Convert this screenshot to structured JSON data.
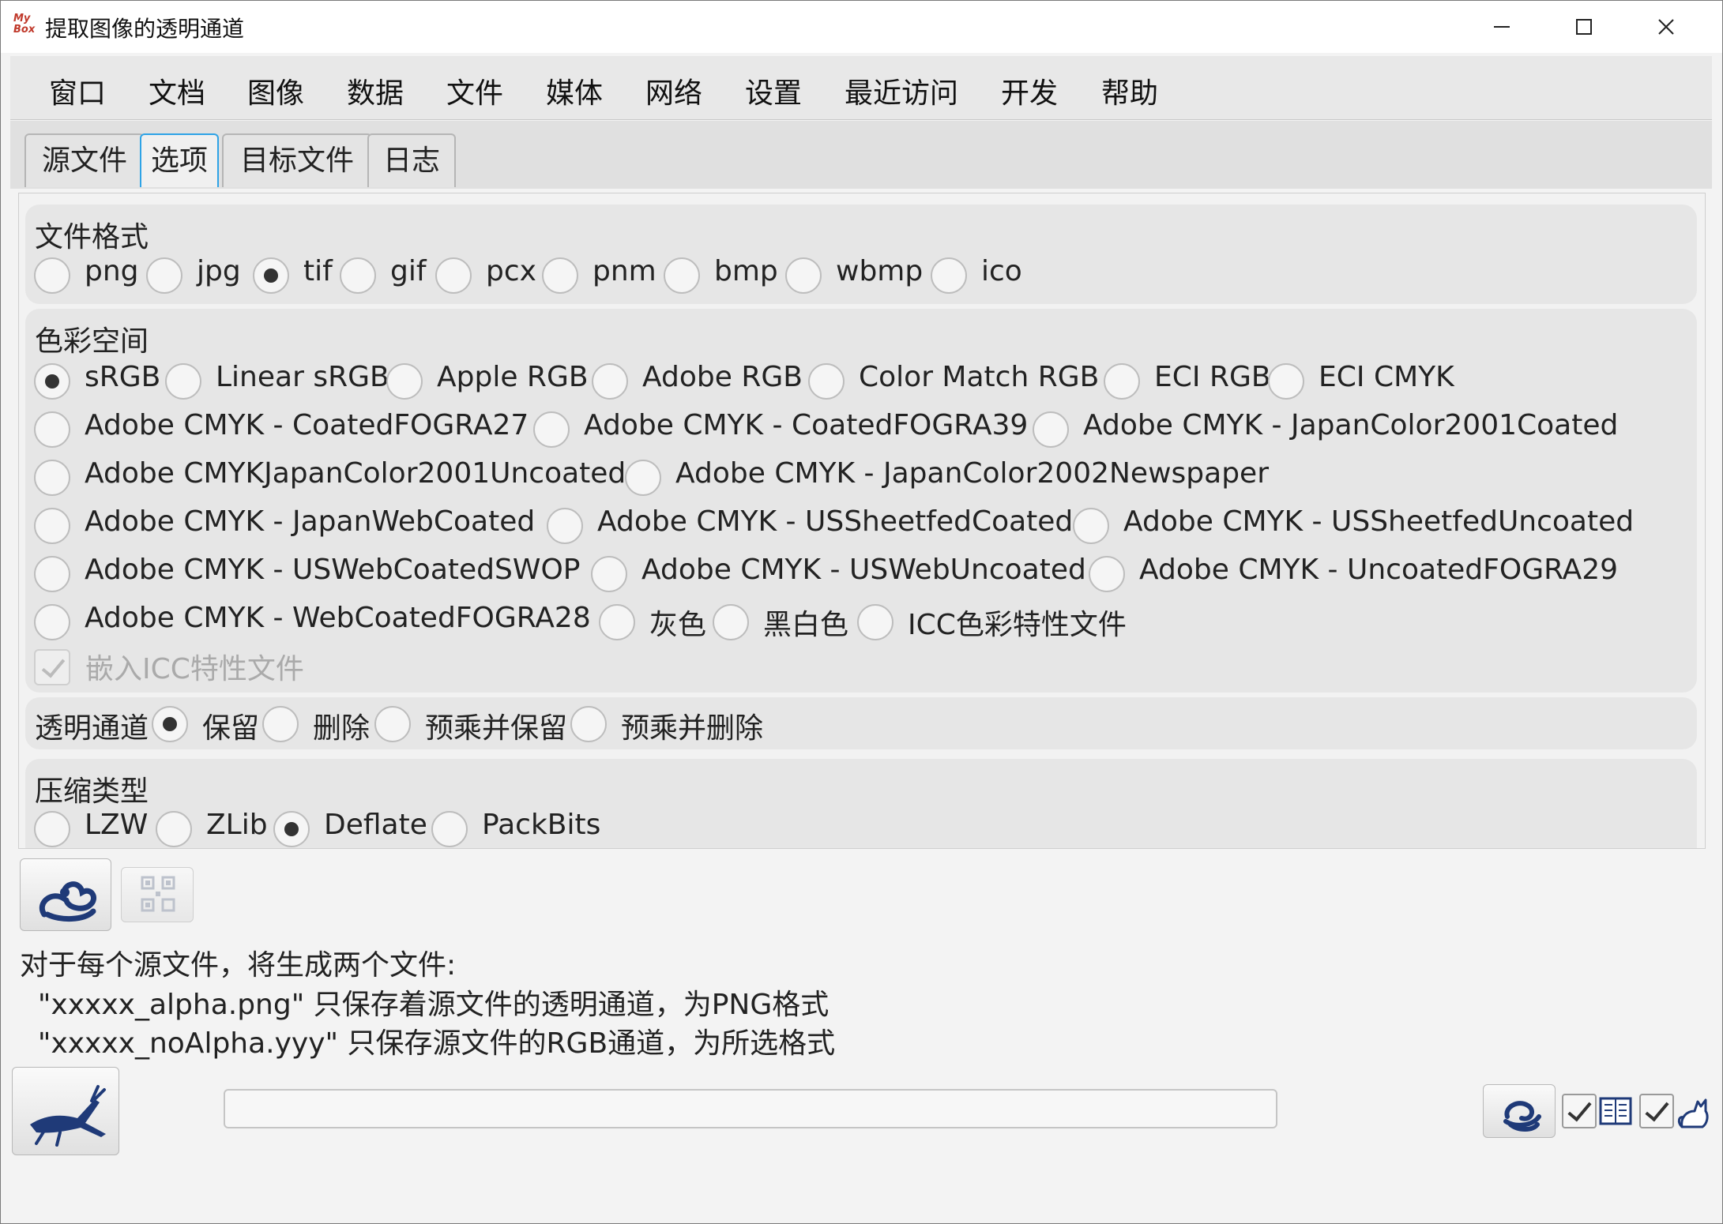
{
  "window": {
    "app_icon_text": "MyBox",
    "title": "提取图像的透明通道",
    "minimize_glyph": "—",
    "maximize_glyph": "☐",
    "close_glyph": "✕"
  },
  "menu": [
    "窗口",
    "文档",
    "图像",
    "数据",
    "文件",
    "媒体",
    "网络",
    "设置",
    "最近访问",
    "开发",
    "帮助"
  ],
  "tabs": [
    {
      "label": "源文件",
      "active": false
    },
    {
      "label": "选项",
      "active": true
    },
    {
      "label": "目标文件",
      "active": false
    },
    {
      "label": "日志",
      "active": false
    }
  ],
  "file_format": {
    "title": "文件格式",
    "options": [
      "png",
      "jpg",
      "tif",
      "gif",
      "pcx",
      "pnm",
      "bmp",
      "wbmp",
      "ico"
    ],
    "selected": "tif"
  },
  "color_space": {
    "title": "色彩空间",
    "rows": [
      [
        "sRGB",
        "Linear sRGB",
        "Apple RGB",
        "Adobe RGB",
        "Color Match RGB",
        "ECI RGB",
        "ECI CMYK"
      ],
      [
        "Adobe CMYK - CoatedFOGRA27",
        "Adobe CMYK - CoatedFOGRA39",
        "Adobe CMYK - JapanColor2001Coated"
      ],
      [
        "Adobe CMYKJapanColor2001Uncoated",
        "Adobe CMYK - JapanColor2002Newspaper"
      ],
      [
        "Adobe CMYK - JapanWebCoated",
        "Adobe CMYK - USSheetfedCoated",
        "Adobe CMYK - USSheetfedUncoated"
      ],
      [
        "Adobe CMYK - USWebCoatedSWOP",
        "Adobe CMYK - USWebUncoated",
        "Adobe CMYK - UncoatedFOGRA29"
      ],
      [
        "Adobe CMYK - WebCoatedFOGRA28",
        "灰色",
        "黑白色",
        "ICC色彩特性文件"
      ]
    ],
    "selected": "sRGB",
    "embed_icc_label": "嵌入ICC特性文件",
    "embed_icc_checked": true,
    "embed_icc_disabled": true
  },
  "alpha": {
    "title": "透明通道",
    "options": [
      "保留",
      "删除",
      "预乘并保留",
      "预乘并删除"
    ],
    "selected": "保留"
  },
  "compression": {
    "title": "压缩类型",
    "options": [
      "LZW",
      "ZLib",
      "Deflate",
      "PackBits"
    ],
    "selected": "Deflate"
  },
  "info_lines": [
    "对于每个源文件，将生成两个文件:",
    "  \"xxxxx_alpha.png\" 只保存着源文件的透明通道，为PNG格式",
    "  \"xxxxx_noAlpha.yyy\" 只保存源文件的RGB通道，为所选格式"
  ],
  "progress": {
    "fraction": 0.0
  },
  "colors": {
    "accent": "#2ea3e6",
    "icon_navy": "#1f3a78"
  },
  "bottom_checks": [
    {
      "name": "open-target-check",
      "checked": true,
      "icon": "book-icon"
    },
    {
      "name": "miao-check",
      "checked": true,
      "icon": "cat-icon"
    }
  ]
}
